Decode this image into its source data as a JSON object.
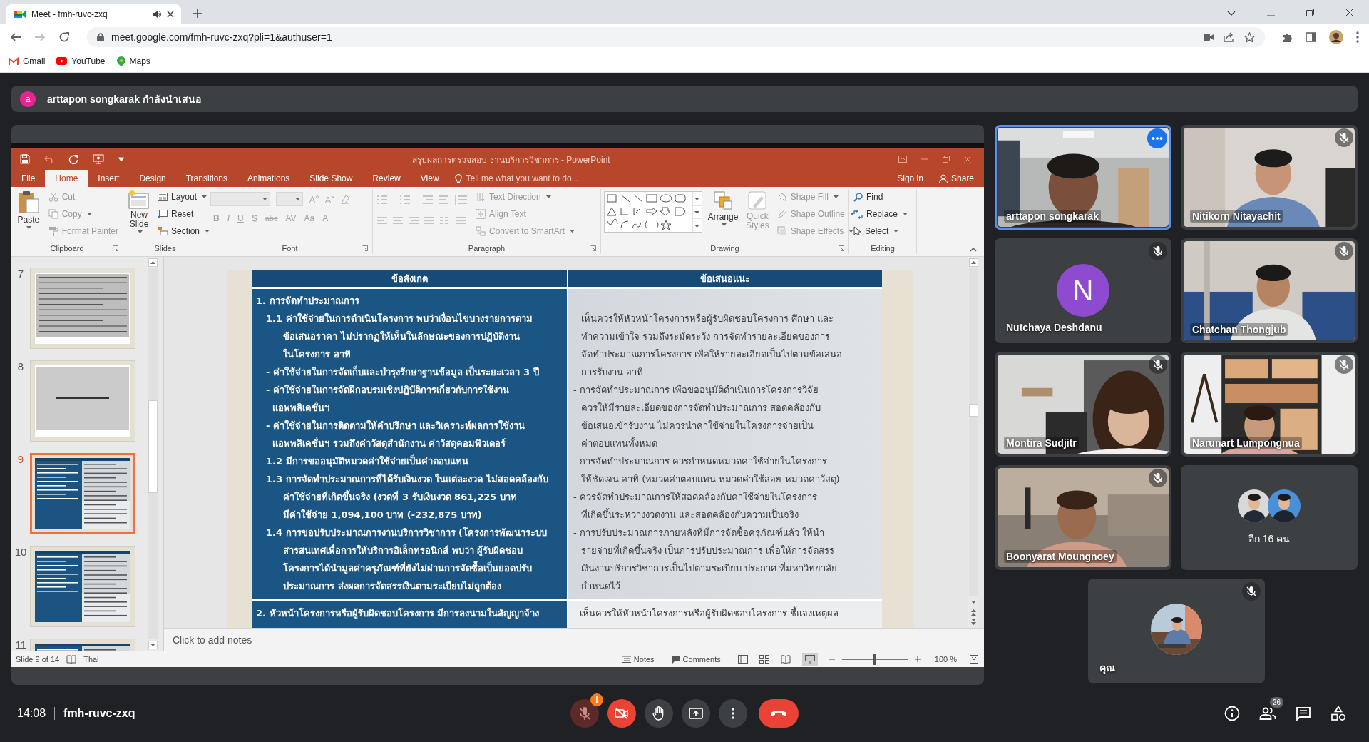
{
  "browser": {
    "tab": {
      "title": "Meet - fmh-ruvc-zxq",
      "audio": true
    },
    "url": "meet.google.com/fmh-ruvc-zxq?pli=1&authuser=1",
    "bookmarks": [
      "Gmail",
      "YouTube",
      "Maps"
    ]
  },
  "presenter_banner": {
    "avatar": "a",
    "text": "arttapon songkarak กำลังนำเสนอ"
  },
  "powerpoint": {
    "title": "สรุปผลการตรวจสอบ งานบริการวิชาการ - PowerPoint",
    "tabs": [
      {
        "label": "File",
        "selected": false
      },
      {
        "label": "Home",
        "selected": true
      },
      {
        "label": "Insert",
        "selected": false
      },
      {
        "label": "Design",
        "selected": false
      },
      {
        "label": "Transitions",
        "selected": false
      },
      {
        "label": "Animations",
        "selected": false
      },
      {
        "label": "Slide Show",
        "selected": false
      },
      {
        "label": "Review",
        "selected": false
      },
      {
        "label": "View",
        "selected": false
      }
    ],
    "tell_me": "Tell me what you want to do...",
    "sign_in": "Sign in",
    "share": "Share",
    "ribbon": {
      "clipboard": {
        "label": "Clipboard",
        "paste": "Paste",
        "items": [
          {
            "label": "Cut",
            "disabled": true
          },
          {
            "label": "Copy",
            "disabled": true
          },
          {
            "label": "Format Painter",
            "disabled": true
          }
        ]
      },
      "slides": {
        "label": "Slides",
        "new_slide": "New Slide",
        "items": [
          {
            "label": "Layout",
            "disabled": false
          },
          {
            "label": "Reset",
            "disabled": false
          },
          {
            "label": "Section",
            "disabled": false
          }
        ]
      },
      "font": {
        "label": "Font",
        "disabled": true,
        "buttons": [
          "B",
          "I",
          "U",
          "S",
          "abc",
          "AV",
          "Aa",
          "A"
        ]
      },
      "paragraph": {
        "label": "Paragraph",
        "disabled": true,
        "items": [
          "Text Direction",
          "Align Text",
          "Convert to SmartArt"
        ]
      },
      "drawing": {
        "label": "Drawing",
        "arrange": {
          "label": "Arrange",
          "disabled": false
        },
        "quick_styles": {
          "label": "Quick Styles",
          "disabled": true
        },
        "items": [
          {
            "label": "Shape Fill",
            "disabled": true
          },
          {
            "label": "Shape Outline",
            "disabled": true
          },
          {
            "label": "Shape Effects",
            "disabled": true
          }
        ]
      },
      "editing": {
        "label": "Editing",
        "items": [
          {
            "label": "Find",
            "disabled": false
          },
          {
            "label": "Replace",
            "disabled": false
          },
          {
            "label": "Select",
            "disabled": false
          }
        ]
      }
    },
    "thumbnails": [
      {
        "number": "7",
        "kind": "text",
        "selected": false
      },
      {
        "number": "8",
        "kind": "title",
        "selected": false
      },
      {
        "number": "9",
        "kind": "table",
        "selected": true
      },
      {
        "number": "10",
        "kind": "table",
        "selected": false
      },
      {
        "number": "11",
        "kind": "table",
        "selected": false
      }
    ],
    "slide": {
      "columns": [
        "ข้อสังเกต",
        "ข้อเสนอแนะ"
      ],
      "sections": [
        {
          "left": [
            {
              "kind": "heading",
              "lines": [
                "1. การจัดทำประมาณการ"
              ]
            },
            {
              "kind": "item",
              "lines": [
                "1.1 ค่าใช้จ่ายในการดำเนินโครงการ พบว่าเงื่อนไขบางรายการตาม",
                "ข้อเสนอราคา ไม่ปรากฏให้เห็นในลักษณะของการปฏิบัติงาน",
                "ในโครงการ  อาทิ"
              ]
            },
            {
              "kind": "dash",
              "lines": [
                "- ค่าใช้จ่ายในการจัดเก็บและบำรุงรักษาฐานข้อมูล เป็นระยะเวลา 3 ปี"
              ]
            },
            {
              "kind": "dash",
              "lines": [
                "- ค่าใช้จ่ายในการจัดฝึกอบรมเชิงปฏิบัติการเกี่ยวกับการใช้งาน",
                "แอพพลิเคชั่นฯ"
              ]
            },
            {
              "kind": "dash",
              "lines": [
                "- ค่าใช้จ่ายในการติดตามให้คำปรึกษา และวิเคราะห์ผลการใช้งาน",
                "แอพพลิเคชั่นฯ รวมถึงค่าวัสดุสำนักงาน ค่าวัสดุคอมพิวเตอร์"
              ]
            },
            {
              "kind": "item",
              "lines": [
                "1.2 มีการขออนุมัติหมวดค่าใช้จ่ายเป็นค่าตอบแทน"
              ]
            },
            {
              "kind": "item",
              "lines": [
                "1.3 การจัดทำประมาณการที่ได้รับเงินงวด ในแต่ละงวด ไม่สอดคล้องกับ",
                "ค่าใช้จ่ายที่เกิดขึ้นจริง (งวดที่ 3 รับเงินงวด 861,225 บาท",
                "มีค่าใช้จ่าย 1,094,100 บาท  (-232,875 บาท)"
              ]
            },
            {
              "kind": "item",
              "lines": [
                "1.4 การขอปรับประมาณการงานบริการวิชาการ (โครงการพัฒนาระบบ",
                "สารสนเทศเพื่อการให้บริการอิเล็กทรอนิกส์  พบว่า ผู้รับผิดชอบ",
                "โครงการได้นำมูลค่าครุภัณฑ์ที่ยังไม่ผ่านการจัดซื้อเป็นยอดปรับ",
                "ประมาณการ ส่งผลการจัดสรรเงินตามระเบียบไม่ถูกต้อง"
              ]
            }
          ],
          "right": [
            {
              "kind": "text",
              "lines": [
                "เห็นควรให้หัวหน้าโครงการหรือผู้รับผิดชอบโครงการ ศึกษา และ",
                "ทำความเข้าใจ รวมถึงระมัดระวัง การจัดทำรายละเอียดของการ",
                "จัดทำประมาณการโครงการ เพื่อให้รายละเอียดเป็นไปตามข้อเสนอ",
                "การรับงาน อาทิ"
              ]
            },
            {
              "kind": "dash",
              "lines": [
                "- การจัดทำประมาณการ เพื่อขออนุมัติดำเนินการโครงการวิจัย",
                "ควรให้มีรายละเอียดของการจัดทำประมาณการ สอดคล้องกับ",
                "ข้อเสนอเข้ารับงาน ไม่ควรนำค่าใช้จ่ายในโครงการจ่ายเป็น",
                "ค่าตอบแทนทั้งหมด"
              ]
            },
            {
              "kind": "dash",
              "lines": [
                "- การจัดทำประมาณการ ควรกำหนดหมวดค่าใช้จ่ายในโครงการ",
                "ให้ชัดเจน อาทิ (หมวดค่าตอบแทน หมวดค่าใช้สอย หมวดค่าวัสดุ)"
              ]
            },
            {
              "kind": "dash",
              "lines": [
                "- ควรจัดทำประมาณการให้สอดคล้องกับค่าใช้จ่ายในโครงการ",
                "ที่เกิดขึ้นระหว่างงวดงาน และสอดคล้องกับความเป็นจริง"
              ]
            },
            {
              "kind": "dash",
              "lines": [
                "- การปรับประมาณการภายหลังที่มีการจัดซื้อครุภัณฑ์แล้ว ให้นำ",
                "รายจ่ายที่เกิดขึ้นจริง เป็นการปรับประมาณการ เพื่อให้การจัดสรร",
                "เงินงานบริการวิชาการเป็นไปตามระเบียบ ประกาศ ที่มหาวิทยาลัย",
                "กำหนดไว้"
              ]
            }
          ]
        },
        {
          "left": [
            {
              "kind": "heading",
              "lines": [
                "2. หัวหน้าโครงการหรือผู้รับผิดชอบโครงการ มีการลงนามในสัญญาจ้าง"
              ]
            }
          ],
          "right": [
            {
              "kind": "dash",
              "lines": [
                "- เห็นควรให้หัวหน้าโครงการหรือผู้รับผิดชอบโครงการ ชี้แจงเหตุผล"
              ]
            }
          ]
        }
      ]
    },
    "notes_placeholder": "Click to add notes",
    "status_bar": {
      "slide": "Slide 9 of 14",
      "language": "Thai",
      "notes": "Notes",
      "comments": "Comments",
      "zoom": "100 %",
      "level": 0.5
    }
  },
  "tiles": [
    {
      "kind": "video",
      "name": "arttapon songkarak",
      "active": true,
      "muted": false
    },
    {
      "kind": "video",
      "name": "Nitikorn Nitayachit",
      "active": false,
      "muted": true
    },
    {
      "kind": "avatar",
      "name": "Nutchaya Deshdanu",
      "initial": "N",
      "active": false,
      "muted": true
    },
    {
      "kind": "video",
      "name": "Chatchan Thongjub",
      "active": false,
      "muted": true
    },
    {
      "kind": "video",
      "name": "Montira Sudjitr",
      "active": false,
      "muted": true
    },
    {
      "kind": "video",
      "name": "Narunart Lumpongnua",
      "active": false,
      "muted": true
    },
    {
      "kind": "video",
      "name": "Boonyarat Moungnoey",
      "active": false,
      "muted": true
    },
    {
      "kind": "others",
      "label": "อีก 16 คน"
    },
    {
      "kind": "self",
      "name": "คุณ",
      "active": false,
      "muted": true
    }
  ],
  "call_bar": {
    "time": "14:08",
    "meeting_code": "fmh-ruvc-zxq",
    "mic_on": false,
    "mic_warning": "!",
    "camera_on": false,
    "people_count": "26"
  }
}
